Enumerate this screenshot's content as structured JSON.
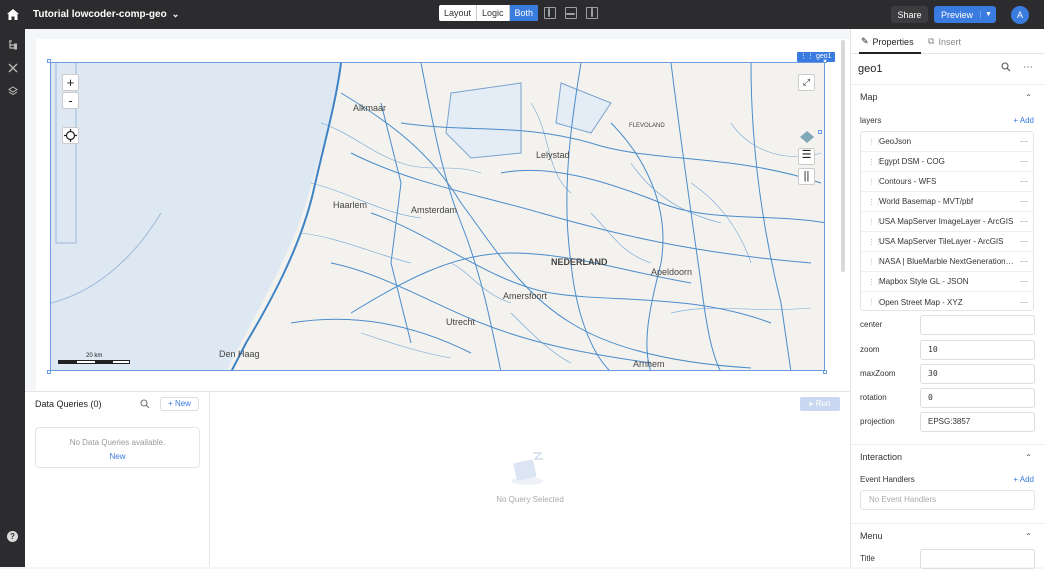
{
  "app": {
    "title": "Tutorial lowcoder-comp-geo"
  },
  "modes": [
    "Layout",
    "Logic",
    "Both"
  ],
  "active_mode": "Both",
  "toolbar": {
    "share_label": "Share",
    "preview_label": "Preview",
    "avatar_initial": "A"
  },
  "component": {
    "tag": "geo1",
    "scale_label": "20 km"
  },
  "map_labels": [
    "Alkmaar",
    "Lelystad",
    "Amsterdam",
    "Utrecht",
    "Amersfoort",
    "NEDERLAND",
    "Apeldoorn",
    "FLEVOLAND",
    "Den Haag",
    "Arnhem",
    "Haarlem"
  ],
  "queries": {
    "title": "Data Queries (0)",
    "new_label": "+ New",
    "empty_text": "No Data Queries available.",
    "empty_link": "New"
  },
  "editor": {
    "run_label": "Run",
    "no_query_text": "No Query Selected"
  },
  "props": {
    "tab_properties": "Properties",
    "tab_insert": "Insert",
    "component_name": "geo1",
    "map_section": "Map",
    "layers_label": "layers",
    "add_label": "+ Add",
    "layers": [
      "GeoJson",
      "Egypt DSM - COG",
      "Contours - WFS",
      "World Basemap - MVT/pbf",
      "USA MapServer ImageLayer - ArcGIS",
      "USA MapServer TileLayer - ArcGIS",
      "NASA | BlueMarble NextGeneration - WMTS",
      "Mapbox Style GL - JSON",
      "Open Street Map - XYZ"
    ],
    "center_label": "center",
    "center_value": "",
    "zoom_label": "zoom",
    "zoom_value": "10",
    "maxzoom_label": "maxZoom",
    "maxzoom_value": "30",
    "rotation_label": "rotation",
    "rotation_value": "0",
    "projection_label": "projection",
    "projection_value": "EPSG:3857",
    "interaction_section": "Interaction",
    "event_handlers_label": "Event Handlers",
    "event_add_label": "+ Add",
    "no_event_handlers": "No Event Handlers",
    "menu_section": "Menu",
    "title_label": "Title",
    "title_value": ""
  }
}
